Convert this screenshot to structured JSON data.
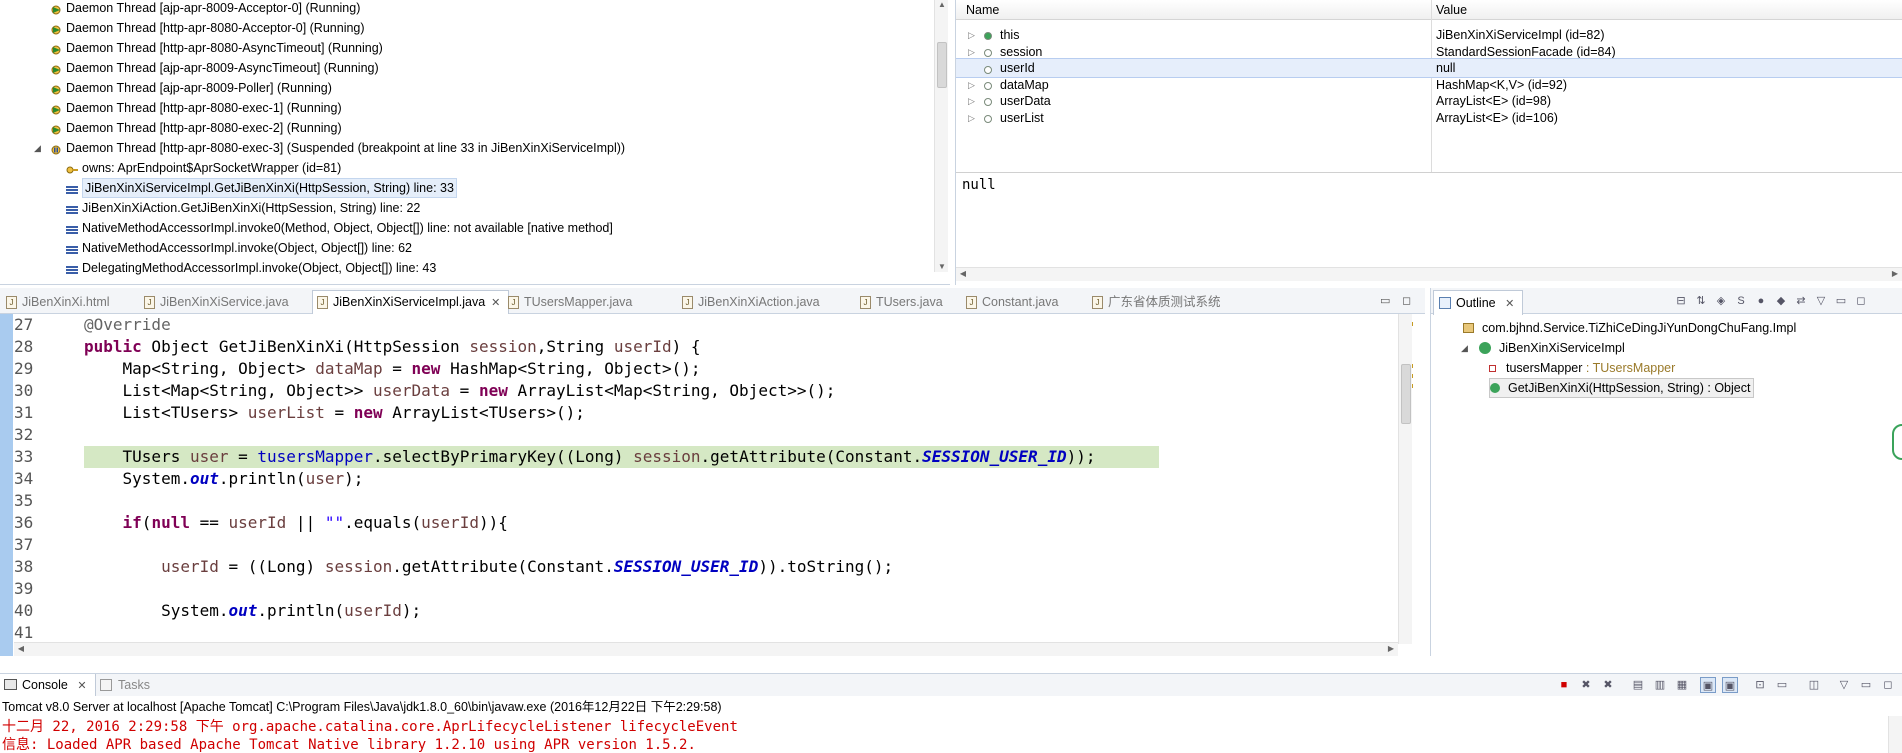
{
  "threads": {
    "items": [
      {
        "label": "Daemon Thread [ajp-apr-8009-Acceptor-0] (Running)",
        "indent": 1,
        "icon": "thread-running-icon"
      },
      {
        "label": "Daemon Thread [http-apr-8080-Acceptor-0] (Running)",
        "indent": 1,
        "icon": "thread-running-icon"
      },
      {
        "label": "Daemon Thread [http-apr-8080-AsyncTimeout] (Running)",
        "indent": 1,
        "icon": "thread-running-icon"
      },
      {
        "label": "Daemon Thread [ajp-apr-8009-AsyncTimeout] (Running)",
        "indent": 1,
        "icon": "thread-running-icon"
      },
      {
        "label": "Daemon Thread [ajp-apr-8009-Poller] (Running)",
        "indent": 1,
        "icon": "thread-running-icon"
      },
      {
        "label": "Daemon Thread [http-apr-8080-exec-1] (Running)",
        "indent": 1,
        "icon": "thread-running-icon"
      },
      {
        "label": "Daemon Thread [http-apr-8080-exec-2] (Running)",
        "indent": 1,
        "icon": "thread-running-icon"
      },
      {
        "label": "Daemon Thread [http-apr-8080-exec-3] (Suspended (breakpoint at line 33 in JiBenXinXiServiceImpl))",
        "indent": 1,
        "icon": "thread-suspended-icon"
      },
      {
        "label": "owns: AprEndpoint$AprSocketWrapper  (id=81)",
        "indent": 2,
        "icon": "monitor-key-icon"
      },
      {
        "label": "JiBenXinXiServiceImpl.GetJiBenXinXi(HttpSession, String) line: 33",
        "indent": 2,
        "icon": "stack-frame-icon"
      },
      {
        "label": "JiBenXinXiAction.GetJiBenXinXi(HttpSession, String) line: 22",
        "indent": 2,
        "icon": "stack-frame-icon"
      },
      {
        "label": "NativeMethodAccessorImpl.invoke0(Method, Object, Object[]) line: not available [native method]",
        "indent": 2,
        "icon": "stack-frame-icon"
      },
      {
        "label": "NativeMethodAccessorImpl.invoke(Object, Object[]) line: 62",
        "indent": 2,
        "icon": "stack-frame-icon"
      },
      {
        "label": "DelegatingMethodAccessorImpl.invoke(Object, Object[]) line: 43",
        "indent": 2,
        "icon": "stack-frame-icon"
      }
    ]
  },
  "variables": {
    "col_name": "Name",
    "col_value": "Value",
    "rows": [
      {
        "name": "this",
        "value": "JiBenXinXiServiceImpl  (id=82)",
        "expandable": true
      },
      {
        "name": "session",
        "value": "StandardSessionFacade  (id=84)",
        "expandable": true
      },
      {
        "name": "userId",
        "value": "null",
        "expandable": false
      },
      {
        "name": "dataMap",
        "value": "HashMap<K,V>  (id=92)",
        "expandable": true
      },
      {
        "name": "userData",
        "value": "ArrayList<E>  (id=98)",
        "expandable": true
      },
      {
        "name": "userList",
        "value": "ArrayList<E>  (id=106)",
        "expandable": true
      }
    ],
    "detail": "null"
  },
  "editor": {
    "tabs": [
      {
        "label": "JiBenXinXi.html",
        "active": false
      },
      {
        "label": "JiBenXinXiService.java",
        "active": false
      },
      {
        "label": "JiBenXinXiServiceImpl.java",
        "active": true
      },
      {
        "label": "TUsersMapper.java",
        "active": false
      },
      {
        "label": "JiBenXinXiAction.java",
        "active": false
      },
      {
        "label": "TUsers.java",
        "active": false
      },
      {
        "label": "Constant.java",
        "active": false
      },
      {
        "label": "广东省体质测试系统",
        "active": false
      }
    ],
    "close_glyph": "✕",
    "lines": [
      {
        "n": "27",
        "text": "@Override"
      },
      {
        "n": "28",
        "text": "public Object GetJiBenXinXi(HttpSession session,String userId) {"
      },
      {
        "n": "29",
        "text": "    Map<String, Object> dataMap = new HashMap<String, Object>();"
      },
      {
        "n": "30",
        "text": "    List<Map<String, Object>> userData = new ArrayList<Map<String, Object>>();"
      },
      {
        "n": "31",
        "text": "    List<TUsers> userList = new ArrayList<TUsers>();"
      },
      {
        "n": "32",
        "text": ""
      },
      {
        "n": "33",
        "text": "    TUsers user = tusersMapper.selectByPrimaryKey((Long) session.getAttribute(Constant.SESSION_USER_ID));"
      },
      {
        "n": "34",
        "text": "    System.out.println(user);"
      },
      {
        "n": "35",
        "text": ""
      },
      {
        "n": "36",
        "text": "    if(null == userId || \"\".equals(userId)){"
      },
      {
        "n": "37",
        "text": ""
      },
      {
        "n": "38",
        "text": "        userId = ((Long) session.getAttribute(Constant.SESSION_USER_ID)).toString();"
      },
      {
        "n": "39",
        "text": ""
      },
      {
        "n": "40",
        "text": "        System.out.println(userId);"
      },
      {
        "n": "41",
        "text": ""
      }
    ]
  },
  "outline": {
    "tab_label": "Outline",
    "items": [
      {
        "label": "com.bjhnd.Service.TiZhiCeDingJiYunDongChuFang.Impl",
        "icon": "package-icon"
      },
      {
        "label": "JiBenXinXiServiceImpl",
        "icon": "class-icon"
      },
      {
        "label": "tusersMapper",
        "type": " : TUsersMapper",
        "icon": "private-field-icon"
      },
      {
        "label": "GetJiBenXinXi(HttpSession, String) : Object",
        "icon": "public-method-icon"
      }
    ]
  },
  "console": {
    "tab_label": "Console",
    "tasks_label": "Tasks",
    "process": "Tomcat v8.0 Server at localhost [Apache Tomcat] C:\\Program Files\\Java\\jdk1.8.0_60\\bin\\javaw.exe (2016年12月22日 下午2:29:58)",
    "lines": [
      "十二月 22, 2016 2:29:58 下午 org.apache.catalina.core.AprLifecycleListener lifecycleEvent",
      "信息: Loaded APR based Apache Tomcat Native library 1.2.10 using APR version 1.5.2."
    ]
  },
  "colors": {
    "keyword": "#7f0055",
    "field": "#0000c0",
    "string": "#2a00ff",
    "current_line": "#d5e8c4",
    "console_error": "#d00000"
  }
}
